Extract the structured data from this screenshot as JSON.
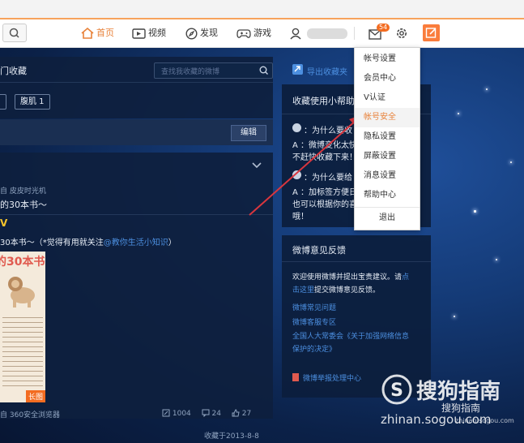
{
  "nav": {
    "home": "首页",
    "video": "视频",
    "discover": "发现",
    "game": "游戏",
    "message_count": "54"
  },
  "favorites": {
    "title": "门收藏",
    "search_placeholder": "查找我收藏的微博",
    "tag_active": "",
    "tag_second": "腹肌 1",
    "edit_button": "编辑",
    "post_source": "自 皮皮时光机",
    "post_title": "的30本书～",
    "post_line2_a": "30本书～（",
    "post_line2_b": "*觉得有用就关注",
    "post_line2_mention": "@教你生活小知识",
    "post_line2_c": "）",
    "image_caption": "的30本书",
    "long_badge": "长图",
    "browser_source": "自 360安全浏览器",
    "repost_count": "1004",
    "comment_count": "24",
    "like_count": "27",
    "saved_date": "收藏于2013-8-8"
  },
  "sidebar": {
    "export_label": "导出收藏夹",
    "guide_title": "收藏使用小帮助",
    "q1": "：为什么要收",
    "a1": "A ：微博变化太快",
    "a1b": "不赶快收藏下来！",
    "q2": "：为什么要给",
    "a2": "A ：加标签方便日",
    "a2b": "也可以根据你的喜",
    "a2c": "哦！",
    "feedback_title": "微博意见反馈",
    "feedback_text1": "欢迎使用微博并提出宝贵建议。请",
    "feedback_link1": "点",
    "feedback_link2": "击这里",
    "feedback_text2": "提交微博意见反馈。",
    "faq_link": "微博常见问题",
    "report_link": "微博客服专区",
    "npc_link": "全国人大常委会《关于加强网络信息",
    "npc_link2": "保护的决定》",
    "center_link": "微博举报处理中心"
  },
  "dropdown": {
    "items": [
      "帐号设置",
      "会员中心",
      "V认证",
      "帐号安全",
      "隐私设置",
      "屏蔽设置",
      "消息设置",
      "帮助中心"
    ],
    "logout": "退出"
  },
  "watermark": {
    "brand": "搜狗指南",
    "brand_small": "搜狗指南",
    "url": "zhinan.sogou.com",
    "url2": "zhinan.sogou.com"
  },
  "colors": {
    "accent": "#e8823a",
    "link": "#4c8fe0",
    "arrow": "#d9363e"
  }
}
